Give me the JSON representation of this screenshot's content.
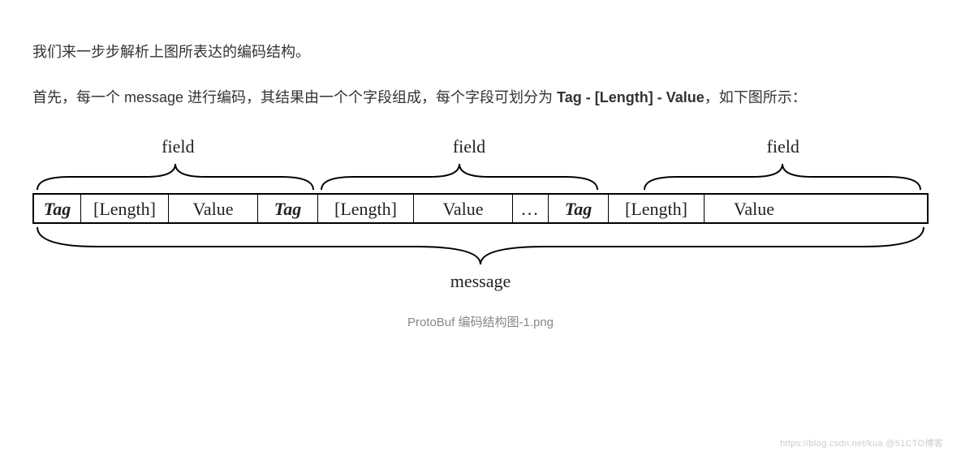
{
  "paragraph1": "我们来一步步解析上图所表达的编码结构。",
  "paragraph2_prefix": "首先，每一个 message 进行编码，其结果由一个个字段组成，每个字段可划分为 ",
  "paragraph2_bold": "Tag - [Length] - Value",
  "paragraph2_suffix": "，如下图所示：",
  "diagram": {
    "field_label": "field",
    "cells": {
      "tag": "Tag",
      "length": "[Length]",
      "value": "Value",
      "dots": "..."
    },
    "message_label": "message"
  },
  "caption": "ProtoBuf 编码结构图-1.png",
  "watermark": "https://blog.csdn.net/kua  @51CTO博客"
}
